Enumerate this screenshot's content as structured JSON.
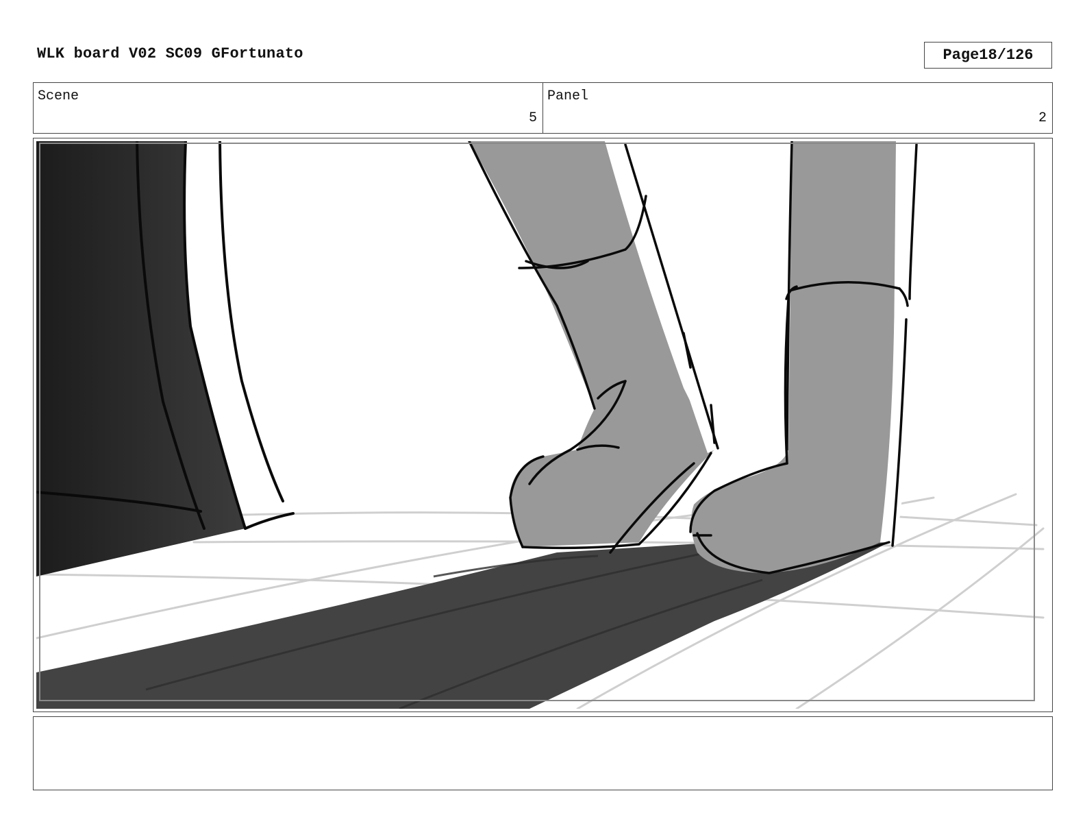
{
  "header": {
    "title": "WLK board V02 SC09 GFortunato",
    "page_label": "Page",
    "page_number": "18/126"
  },
  "info": {
    "scene_label": "Scene",
    "scene_value": "5",
    "panel_label": "Panel",
    "panel_value": "2"
  },
  "notes": {
    "text": ""
  }
}
